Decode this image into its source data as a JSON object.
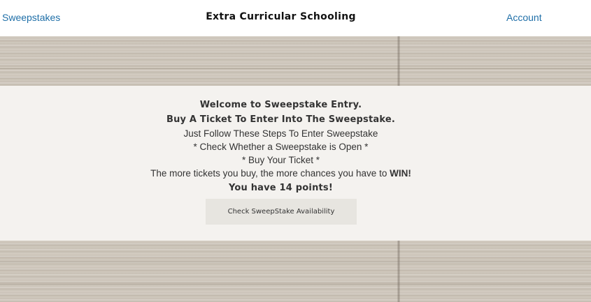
{
  "header": {
    "left_link": "Sweepstakes",
    "title": "Extra Curricular Schooling",
    "right_link": "Account"
  },
  "main": {
    "welcome": "Welcome to Sweepstake Entry.",
    "buy_line": "Buy A Ticket To Enter Into The Sweepstake.",
    "steps_intro": "Just Follow These Steps To Enter Sweepstake",
    "step_1": "* Check Whether a Sweepstake is Open *",
    "step_2": "* Buy Your Ticket *",
    "chances_text": "The more tickets you buy, the more chances you have to ",
    "chances_emphasis": "WIN!",
    "points_prefix": "You have ",
    "points_value": "14",
    "points_suffix": " points!",
    "button_label": "Check SweepStake Availability"
  },
  "colors": {
    "link": "#1f6fa8",
    "panel_bg": "#f4f2ef",
    "button_bg": "#e7e5e0"
  }
}
